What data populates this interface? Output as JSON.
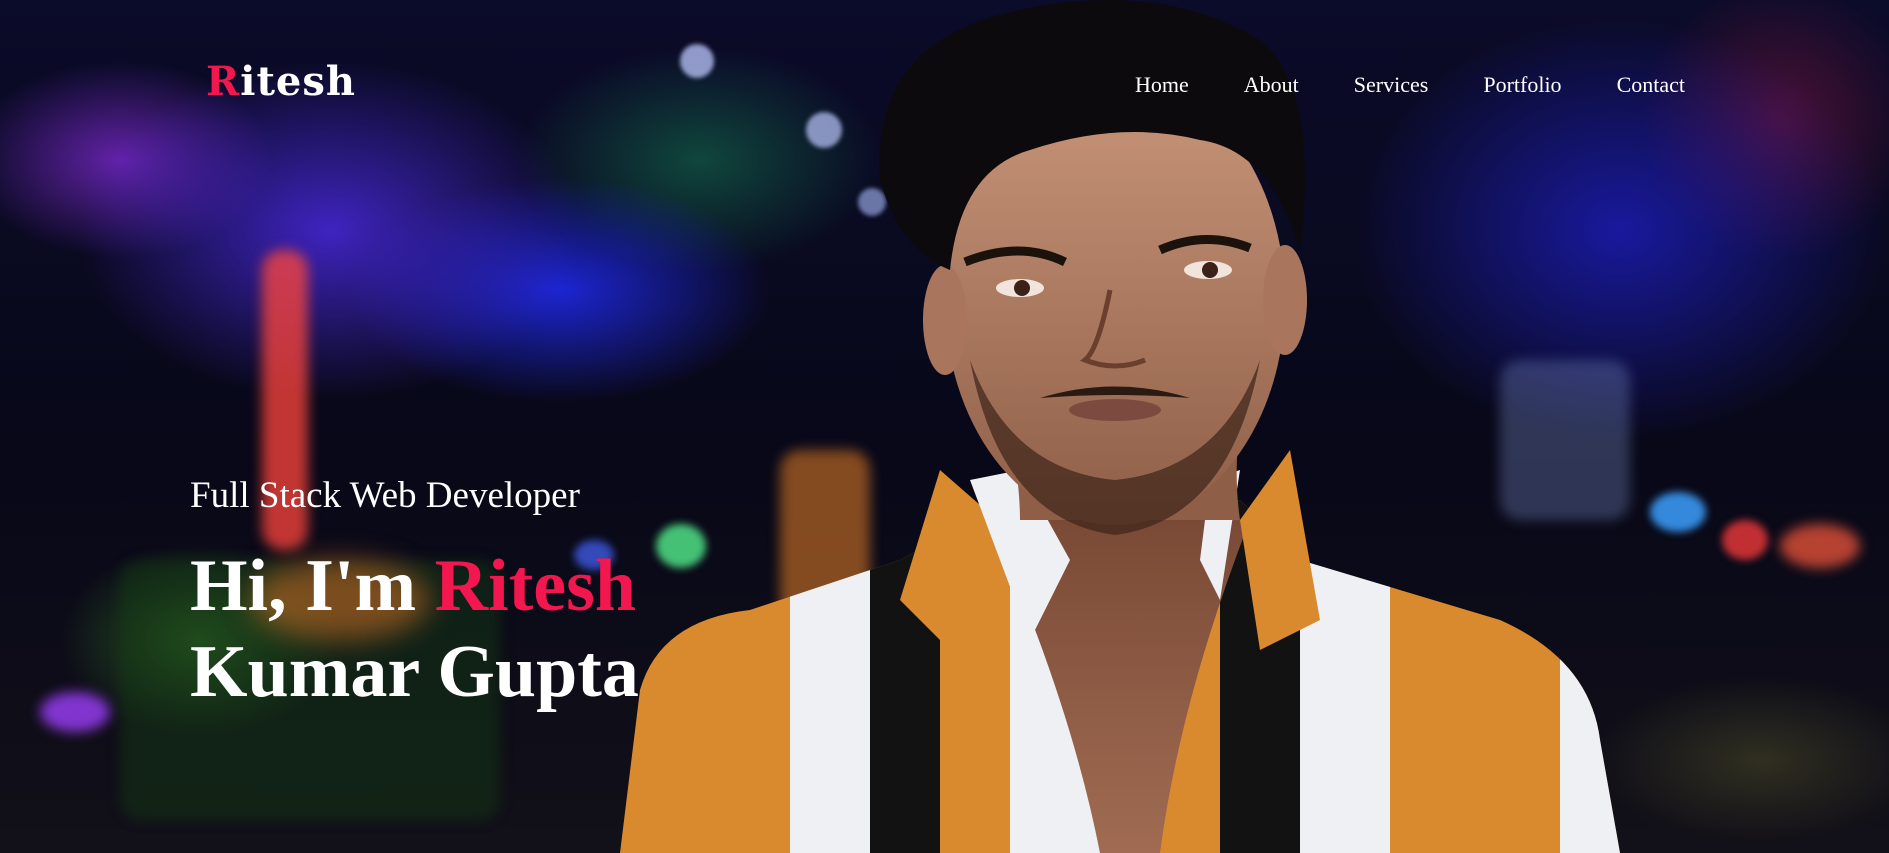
{
  "logo": {
    "first_letter": "R",
    "rest": "itesh"
  },
  "nav": {
    "items": [
      {
        "label": "Home"
      },
      {
        "label": "About"
      },
      {
        "label": "Services"
      },
      {
        "label": "Portfolio"
      },
      {
        "label": "Contact"
      }
    ]
  },
  "hero": {
    "subtitle": "Full Stack Web Developer",
    "greeting": "Hi, I'm ",
    "name_highlight": "Ritesh",
    "name_rest": "Kumar Gupta"
  },
  "colors": {
    "accent": "#f2174f",
    "text": "#ffffff"
  }
}
